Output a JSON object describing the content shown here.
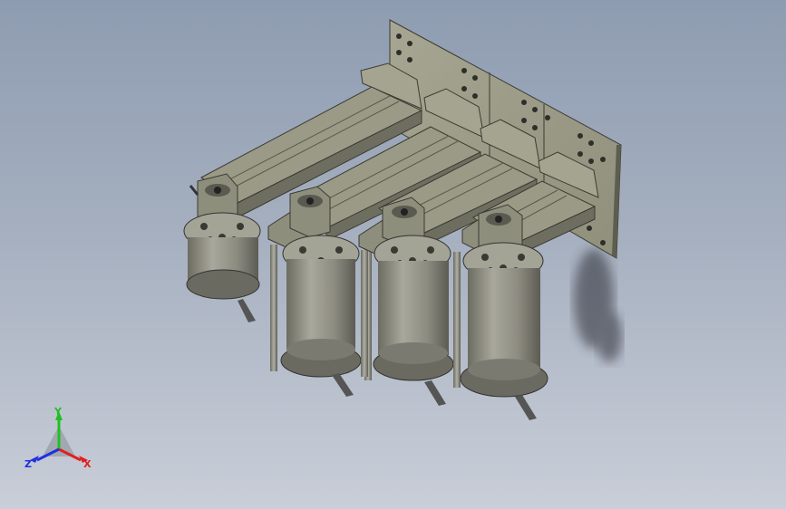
{
  "view": {
    "background_top": "#8e9cb1",
    "background_bottom": "#c9ced8",
    "model_name": ""
  },
  "model": {
    "plate_color": "#9a9a86",
    "rail_color": "#8a8a78",
    "cylinder_color": "#86857a",
    "units": [
      "unit-1",
      "unit-2",
      "unit-3",
      "unit-4"
    ]
  },
  "triad": {
    "x_label": "X",
    "y_label": "Y",
    "z_label": "Z",
    "x_color": "#e02020",
    "y_color": "#20c020",
    "z_color": "#2030e0"
  }
}
